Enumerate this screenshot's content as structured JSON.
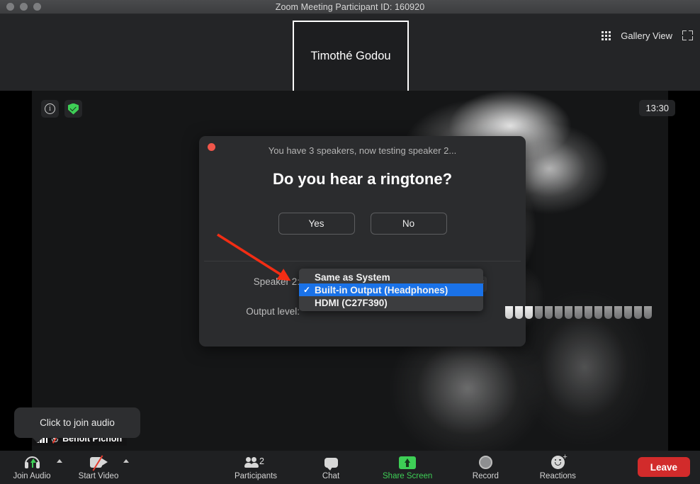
{
  "window": {
    "title": "Zoom Meeting Participant ID: 160920",
    "traffic_lights": [
      "close",
      "minimize",
      "maximize"
    ]
  },
  "ribbon": {
    "thumbnail_name": "Timothé Godou",
    "view_mode_label": "Gallery View",
    "grid_icon": "grid-icon",
    "fullscreen_icon": "fullscreen-icon"
  },
  "stage": {
    "info_icon": "info-icon",
    "encryption_icon": "shield-check-icon",
    "timer": "13:30",
    "participant_name": "Benoit Pichon",
    "signal_icon": "signal-bars-icon",
    "mic_icon": "mic-muted-icon"
  },
  "tooltip": {
    "text": "Click to join audio"
  },
  "dialog": {
    "close_icon": "close-dot-icon",
    "subtitle": "You have 3 speakers, now testing speaker 2...",
    "title": "Do you hear a ringtone?",
    "yes_label": "Yes",
    "no_label": "No",
    "speaker_label": "Speaker 2:",
    "output_label": "Output level:",
    "stepper_icon": "stepper-chevrons-icon",
    "selected_speaker": "Built-in Output (Headphones)",
    "options": [
      {
        "label": "Same as System",
        "selected": false
      },
      {
        "label": "Built-in Output (Headphones)",
        "selected": true
      },
      {
        "label": "HDMI (C27F390)",
        "selected": false
      }
    ],
    "meter_total": 15,
    "meter_active": 3,
    "highlight_color": "#1a72e8"
  },
  "annotation": {
    "arrow_color": "#f22d14",
    "name": "red-pointer-arrow"
  },
  "toolbar": {
    "items": [
      {
        "label": "Join Audio",
        "icon": "headset-icon",
        "has_caret": true,
        "green": false
      },
      {
        "label": "Start Video",
        "icon": "camera-off-icon",
        "has_caret": true,
        "green": false
      },
      {
        "label": "Participants",
        "icon": "people-icon",
        "count": "2",
        "has_caret": false,
        "green": false
      },
      {
        "label": "Chat",
        "icon": "chat-bubble-icon",
        "has_caret": false,
        "green": false
      },
      {
        "label": "Share Screen",
        "icon": "share-screen-icon",
        "has_caret": false,
        "green": true
      },
      {
        "label": "Record",
        "icon": "record-circle-icon",
        "has_caret": false,
        "green": false
      },
      {
        "label": "Reactions",
        "icon": "reactions-smiley-icon",
        "has_caret": false,
        "green": false
      }
    ],
    "leave_label": "Leave",
    "leave_color": "#d22b2b"
  }
}
